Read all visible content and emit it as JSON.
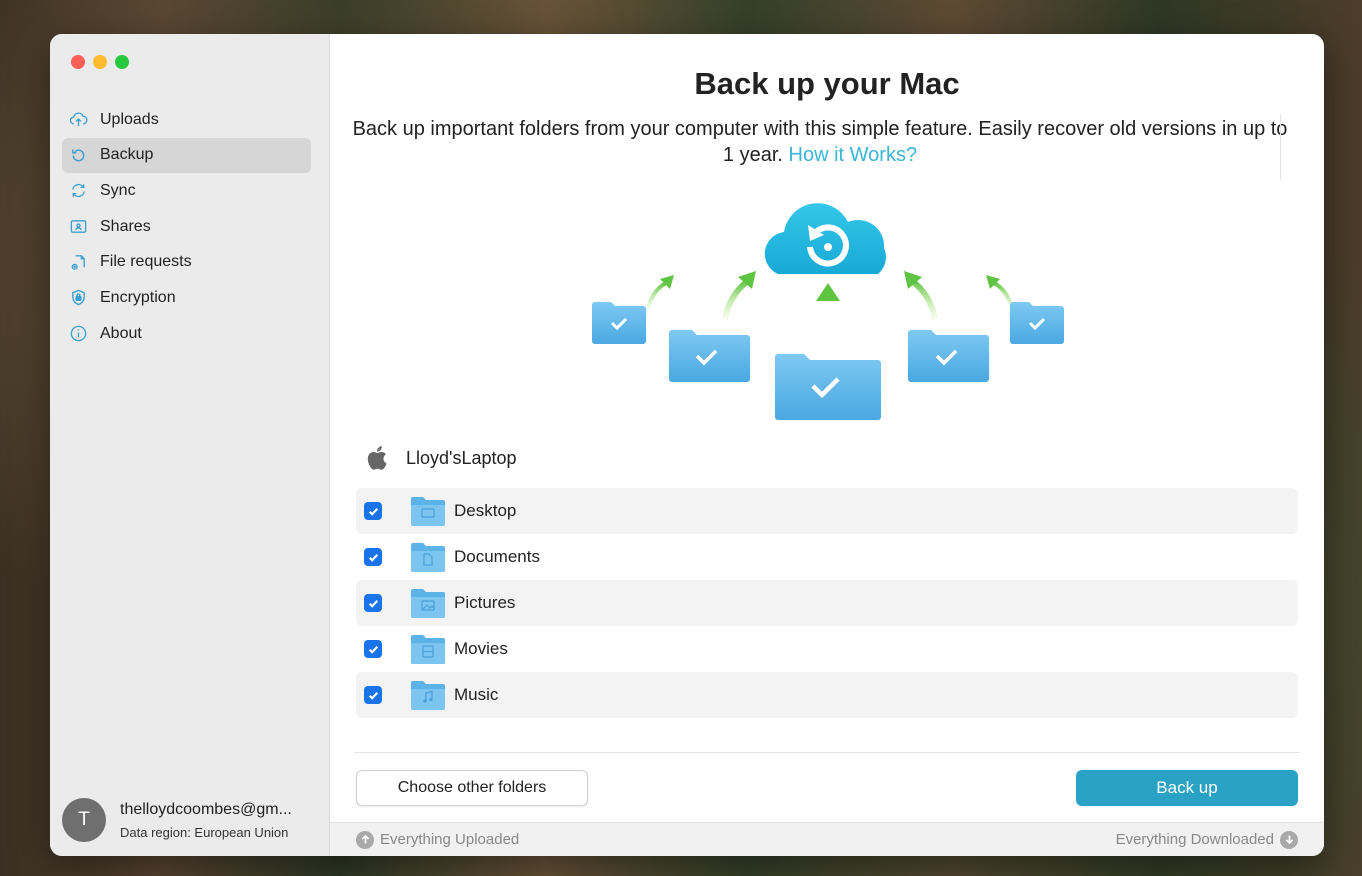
{
  "window": {
    "traffic_lights": [
      "#fe5f57",
      "#febc2e",
      "#28c840"
    ]
  },
  "sidebar": {
    "items": [
      {
        "label": "Uploads",
        "icon": "upload-cloud-icon"
      },
      {
        "label": "Backup",
        "icon": "backup-icon",
        "active": true
      },
      {
        "label": "Sync",
        "icon": "sync-icon"
      },
      {
        "label": "Shares",
        "icon": "shares-icon"
      },
      {
        "label": "File requests",
        "icon": "file-request-icon"
      },
      {
        "label": "Encryption",
        "icon": "lock-icon"
      },
      {
        "label": "About",
        "icon": "info-icon"
      }
    ],
    "account": {
      "avatar_letter": "T",
      "email": "thelloydcoombes@gm...",
      "region": "Data region: European Union"
    }
  },
  "main": {
    "title": "Back up your Mac",
    "description": "Back up important folders from your computer with this simple feature. Easily recover old versions in up to 1 year.",
    "how_link": "How it Works?",
    "machine_name": "Lloyd'sLaptop",
    "folders": [
      {
        "label": "Desktop",
        "checked": true,
        "icon": "desktop-folder-icon"
      },
      {
        "label": "Documents",
        "checked": true,
        "icon": "documents-folder-icon"
      },
      {
        "label": "Pictures",
        "checked": true,
        "icon": "pictures-folder-icon"
      },
      {
        "label": "Movies",
        "checked": true,
        "icon": "movies-folder-icon"
      },
      {
        "label": "Music",
        "checked": true,
        "icon": "music-folder-icon"
      }
    ],
    "choose_button": "Choose other folders",
    "backup_button": "Back up"
  },
  "status": {
    "uploaded": "Everything Uploaded",
    "downloaded": "Everything Downloaded"
  },
  "colors": {
    "accent": "#2aa2c6",
    "link": "#3bb5d8",
    "checkbox": "#1a73e8",
    "folder": "#5cb3e8"
  }
}
